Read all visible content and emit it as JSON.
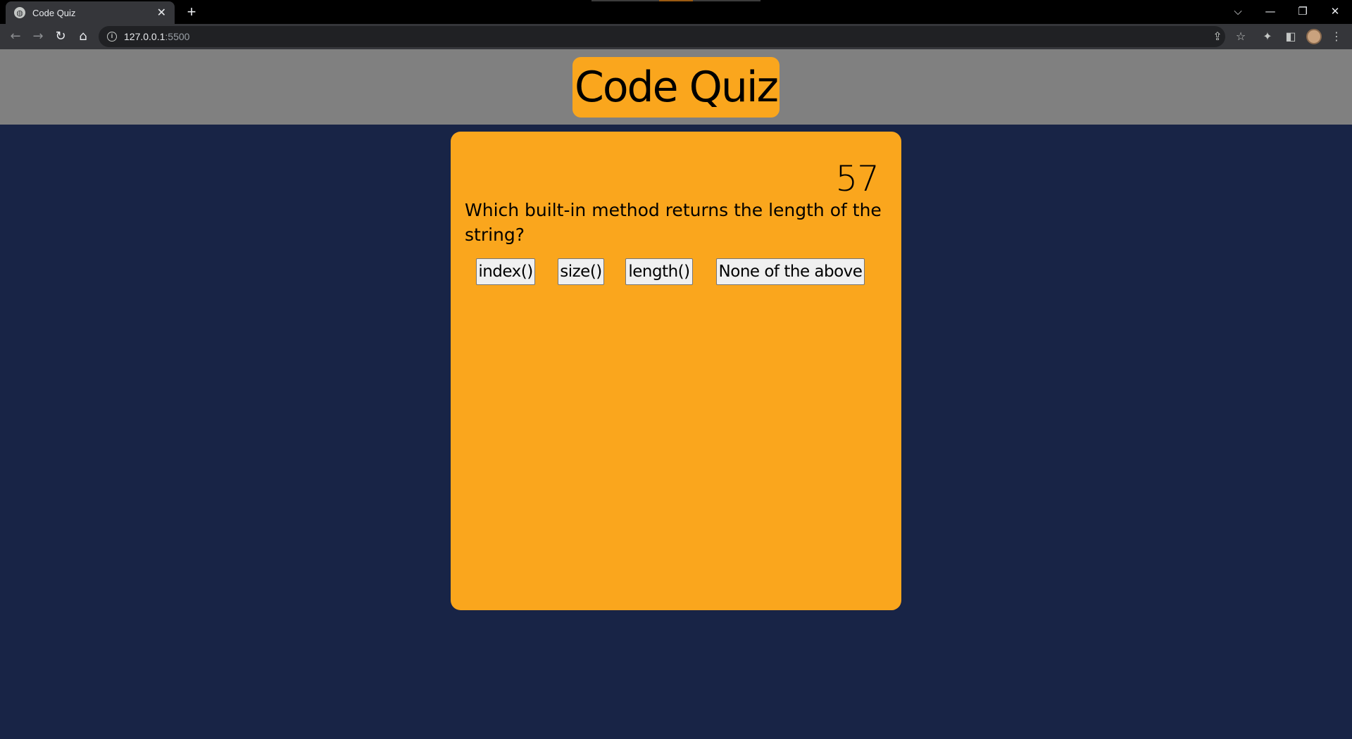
{
  "browser": {
    "tab_title": "Code Quiz",
    "tab_close": "✕",
    "new_tab": "+",
    "url_host": "127.0.0.1",
    "url_port": ":5500",
    "window_controls": [
      "⌵",
      "—",
      "❐",
      "✕"
    ],
    "icons": {
      "back": "back-arrow-icon",
      "forward": "forward-arrow-icon",
      "reload": "reload-icon",
      "home": "home-icon",
      "info": "info-icon",
      "share": "share-icon",
      "bookmark": "star-icon",
      "extensions": "puzzle-icon",
      "side_panel": "side-panel-icon",
      "profile": "avatar-icon",
      "menu": "kebab-menu-icon"
    }
  },
  "page": {
    "title": "Code Quiz",
    "colors": {
      "background": "#182446",
      "header": "#808080",
      "accent": "#faa61d"
    }
  },
  "quiz": {
    "timer": "57",
    "question": "Which built-in method returns the length of the string?",
    "answers": [
      "index()",
      "size()",
      "length()",
      "None of the above"
    ]
  }
}
